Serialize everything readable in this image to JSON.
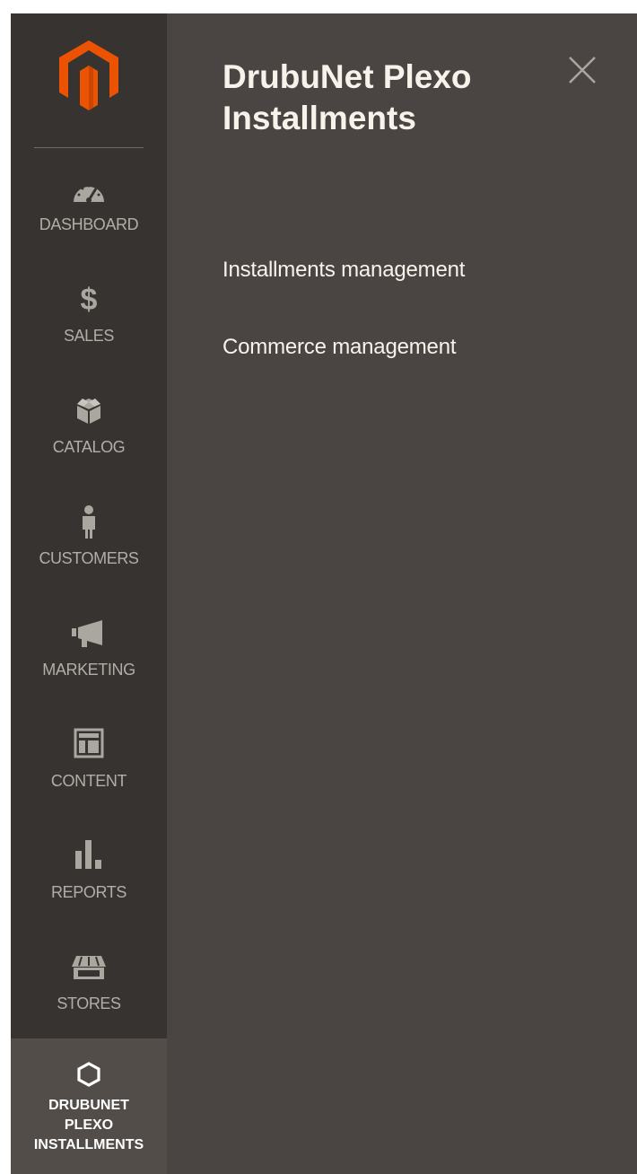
{
  "sidebar": {
    "logo": "magento-logo-icon",
    "items": [
      {
        "label": "DASHBOARD",
        "icon": "speedometer-icon"
      },
      {
        "label": "SALES",
        "icon": "dollar-icon"
      },
      {
        "label": "CATALOG",
        "icon": "box-icon"
      },
      {
        "label": "CUSTOMERS",
        "icon": "person-icon"
      },
      {
        "label": "MARKETING",
        "icon": "megaphone-icon"
      },
      {
        "label": "CONTENT",
        "icon": "layout-icon"
      },
      {
        "label": "REPORTS",
        "icon": "bar-chart-icon"
      },
      {
        "label": "STORES",
        "icon": "storefront-icon"
      },
      {
        "label_lines": [
          "DRUBUNET",
          "PLEXO",
          "INSTALLMENTS"
        ],
        "icon": "hexagon-icon",
        "active": true
      }
    ]
  },
  "panel": {
    "title_lines": [
      "DrubuNet Plexo",
      "Installments"
    ],
    "links": [
      "Installments management",
      "Commerce management"
    ]
  },
  "colors": {
    "sidebar_bg": "#373330",
    "panel_bg": "#4a4542",
    "active_bg": "#524d49",
    "logo_orange": "#eb5202",
    "nav_text": "#aaa6a0",
    "panel_text": "#f7f3eb"
  }
}
